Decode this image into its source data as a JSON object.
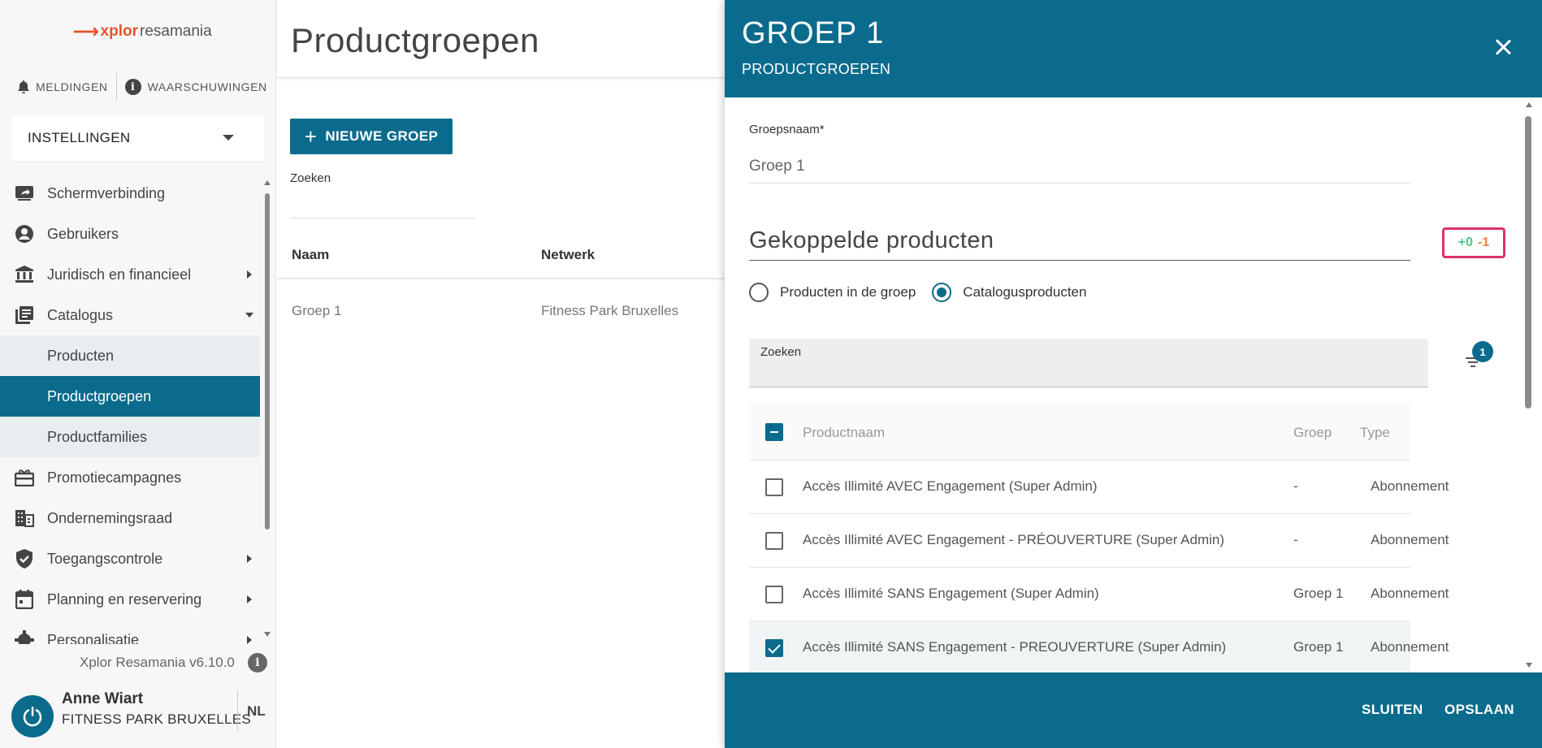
{
  "brand": {
    "mark": "⟶",
    "x": "xplor",
    "name": " resamania"
  },
  "notifications": {
    "alerts": "MELDINGEN",
    "warnings": "WAARSCHUWINGEN"
  },
  "settings_select": "INSTELLINGEN",
  "nav": {
    "items": [
      {
        "label": "Schermverbinding",
        "icon": "screen-share-icon"
      },
      {
        "label": "Gebruikers",
        "icon": "account-circle-icon"
      },
      {
        "label": "Juridisch en financieel",
        "icon": "bank-icon"
      },
      {
        "label": "Catalogus",
        "icon": "library-books-icon"
      }
    ],
    "sub_items": [
      {
        "label": "Producten"
      },
      {
        "label": "Productgroepen"
      },
      {
        "label": "Productfamilies"
      }
    ],
    "items_after": [
      {
        "label": "Promotiecampagnes",
        "icon": "card-giftcard-icon"
      },
      {
        "label": "Ondernemingsraad",
        "icon": "business-icon"
      },
      {
        "label": "Toegangscontrole",
        "icon": "shield-check-icon"
      },
      {
        "label": "Planning en reservering",
        "icon": "calendar-icon"
      },
      {
        "label": "Personalisatie",
        "icon": "gear-icon"
      }
    ]
  },
  "version": "Xplor Resamania v6.10.0",
  "user": {
    "name": "Anne Wiart",
    "org": "FITNESS PARK BRUXELLES",
    "lang": "NL"
  },
  "main": {
    "title": "Productgroepen",
    "new_group": "NIEUWE GROEP",
    "search_label": "Zoeken",
    "columns": [
      "Naam",
      "Netwerk"
    ],
    "rows": [
      {
        "name": "Groep 1",
        "network": "Fitness Park Bruxelles"
      }
    ]
  },
  "drawer": {
    "title": "GROEP 1",
    "subtitle": "PRODUCTGROEPEN",
    "name_label": "Groepsnaam*",
    "name_value": "Groep 1",
    "section_title": "Gekoppelde producten",
    "counter_plus": "+0",
    "counter_minus": "-1",
    "radio_options": [
      "Producten in de groep",
      "Catalogusproducten"
    ],
    "radio_selected": 1,
    "search_label": "Zoeken",
    "filter_badge": "1",
    "table": {
      "headers": [
        "Productnaam",
        "Groep",
        "Type"
      ],
      "rows": [
        {
          "name": "Accès Illimité AVEC Engagement (Super Admin)",
          "group": "-",
          "type": "Abonnement",
          "checked": false
        },
        {
          "name": "Accès Illimité AVEC Engagement - PRÉOUVERTURE (Super Admin)",
          "group": "-",
          "type": "Abonnement",
          "checked": false
        },
        {
          "name": "Accès Illimité SANS Engagement (Super Admin)",
          "group": "Groep 1",
          "type": "Abonnement",
          "checked": false
        },
        {
          "name": "Accès Illimité SANS Engagement - PREOUVERTURE (Super Admin)",
          "group": "Groep 1",
          "type": "Abonnement",
          "checked": true
        }
      ]
    },
    "close_label": "SLUITEN",
    "save_label": "OPSLAAN"
  },
  "colors": {
    "primary": "#0b6b8d",
    "brand": "#e8542b",
    "highlight": "#e0306c",
    "plus": "#4fc58a",
    "minus": "#f0803c"
  }
}
